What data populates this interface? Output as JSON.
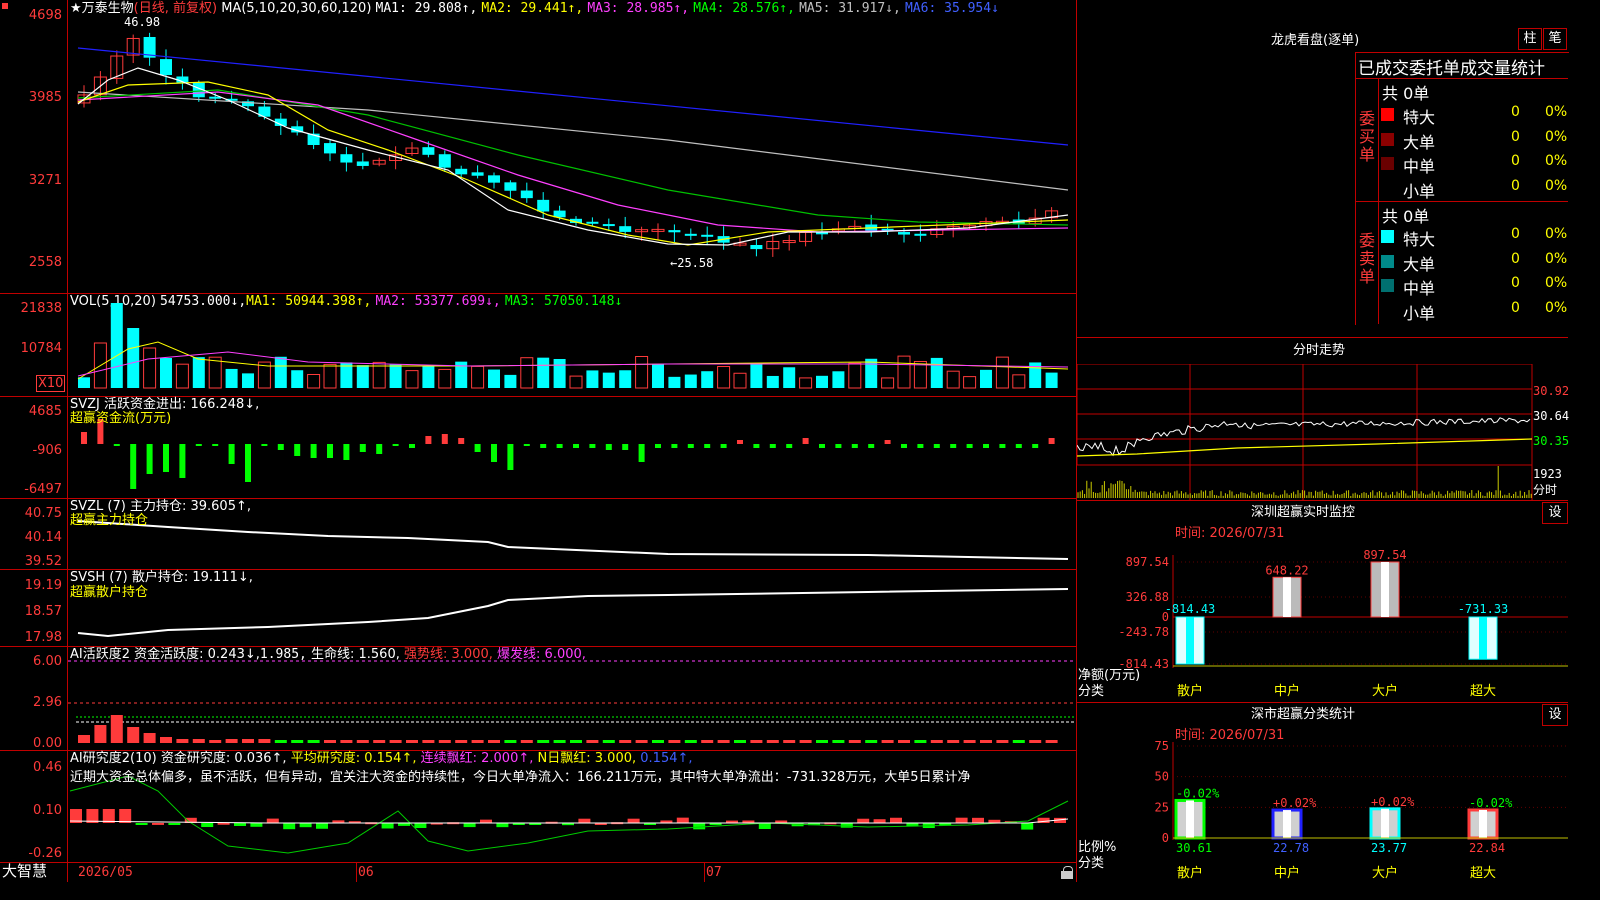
{
  "stock": {
    "name": "★万泰生物",
    "mode": "(日线, 前复权)",
    "ma_label": "MA(5,10,20,30,60,120)",
    "ma": [
      {
        "label": "MA1: 29.808↑,",
        "color": "#ffffff"
      },
      {
        "label": "MA2: 29.441↑,",
        "color": "#ffff00"
      },
      {
        "label": "MA3: 28.985↑,",
        "color": "#ff40ff"
      },
      {
        "label": "MA4: 28.576↑,",
        "color": "#00ff00"
      },
      {
        "label": "MA5: 31.917↓,",
        "color": "#c0c0c0"
      },
      {
        "label": "MA6: 35.954↓",
        "color": "#4060ff"
      }
    ],
    "high_mark": "46.98",
    "low_mark": "←25.58"
  },
  "price_axis": [
    "4698",
    "3985",
    "3271",
    "2558"
  ],
  "vol": {
    "title": "VOL(5,10,20)",
    "value": "54753.000↓,",
    "ma1": "MA1: 50944.398↑,",
    "ma2": "MA2: 53377.699↓,",
    "ma3": "MA3: 57050.148↓",
    "axis": [
      "21838",
      "10784"
    ],
    "unit": "X10"
  },
  "svzj": {
    "title": "SVZJ  活跃资金进出: 166.248↓,",
    "subtitle": "超赢资金流(万元)",
    "axis": [
      "4685",
      "-906",
      "-6497"
    ]
  },
  "svzl": {
    "title": "SVZL (7) 主力持仓: 39.605↑,",
    "subtitle": "超赢主力持仓",
    "axis": [
      "40.75",
      "40.14",
      "39.52"
    ]
  },
  "svsh": {
    "title": "SVSH (7) 散户持仓: 19.111↓,",
    "subtitle": "超赢散户持仓",
    "axis": [
      "19.19",
      "18.57",
      "17.98"
    ]
  },
  "ai1": {
    "t1": "AI活跃度2 资金活跃度: 0.243↓,",
    "t2": "1.985,",
    "t3": "生命线: 1.560,",
    "t4": "强势线: 3.000,",
    "t5": "爆发线: 6.000,",
    "axis": [
      "6.00",
      "2.96",
      "0.00"
    ]
  },
  "ai2": {
    "t1": "AI研究度2(10) 资金研究度: 0.036↑,",
    "t2": "平均研究度: 0.154↑,",
    "t3": "连续飘红: 2.000↑,",
    "t4": "N日飘红: 3.000,",
    "t5": "0.154↑,",
    "comment": "近期大资金总体偏多，虽不活跃，但有异动，宜关注大资金的持续性，今日大单净流入：166.211万元，其中特大单净流出：-731.328万元，大单5日累计净",
    "axis": [
      "0.46",
      "0.10",
      "-0.26"
    ]
  },
  "bottom": {
    "brand": "大智慧",
    "dates": [
      "2026/05",
      "06",
      "07"
    ]
  },
  "lhb": {
    "title": "龙虎看盘(逐单)",
    "btn1": "柱",
    "btn2": "笔",
    "header": "已成交委托单成交量统计",
    "buy_label": "委买单",
    "sell_label": "委卖单",
    "buy_total": "共 0单",
    "sell_total": "共 0单",
    "buy_rows": [
      {
        "name": "特大",
        "val": "0",
        "pct": "0%",
        "color": "#ff0000"
      },
      {
        "name": "大单",
        "val": "0",
        "pct": "0%",
        "color": "#8b0000"
      },
      {
        "name": "中单",
        "val": "0",
        "pct": "0%",
        "color": "#6a0000"
      },
      {
        "name": "小单",
        "val": "0",
        "pct": "0%",
        "color": "#000000"
      }
    ],
    "sell_rows": [
      {
        "name": "特大",
        "val": "0",
        "pct": "0%",
        "color": "#00ffff"
      },
      {
        "name": "大单",
        "val": "0",
        "pct": "0%",
        "color": "#008b8b"
      },
      {
        "name": "中单",
        "val": "0",
        "pct": "0%",
        "color": "#007070"
      },
      {
        "name": "小单",
        "val": "0",
        "pct": "0%",
        "color": "#000000"
      }
    ]
  },
  "fenshi": {
    "title": "分时走势",
    "axis": [
      "30.92",
      "30.64",
      "30.35"
    ],
    "vol": "1923",
    "vol_label": "分时"
  },
  "monitor": {
    "title": "深圳超赢实时监控",
    "btn": "设",
    "time": "时间: 2026/07/31",
    "axis": [
      "897.54",
      "326.88",
      "0",
      "-243.78",
      "-814.43"
    ],
    "side1": "净额(万元)",
    "side2": "分类",
    "bars": [
      {
        "cat": "散户",
        "value": -814.43,
        "label": "-814.43"
      },
      {
        "cat": "中户",
        "value": 648.22,
        "label": "648.22"
      },
      {
        "cat": "大户",
        "value": 897.54,
        "label": "897.54"
      },
      {
        "cat": "超大",
        "value": -731.33,
        "label": "-731.33"
      }
    ]
  },
  "stat": {
    "title": "深市超赢分类统计",
    "btn": "设",
    "time": "时间: 2026/07/31",
    "axis": [
      "75",
      "50",
      "25",
      "0"
    ],
    "side1": "比例%",
    "side2": "分类",
    "bars": [
      {
        "cat": "散户",
        "value": 30.61,
        "label": "30.61",
        "change": "-0.02%"
      },
      {
        "cat": "中户",
        "value": 22.78,
        "label": "22.78",
        "change": "+0.02%"
      },
      {
        "cat": "大户",
        "value": 23.77,
        "label": "23.77",
        "change": "+0.02%"
      },
      {
        "cat": "超大",
        "value": 22.84,
        "label": "22.84",
        "change": "-0.02%"
      }
    ]
  },
  "chart_data": [
    {
      "type": "bar",
      "title": "深圳超赢实时监控",
      "categories": [
        "散户",
        "中户",
        "大户",
        "超大"
      ],
      "values": [
        -814.43,
        648.22,
        897.54,
        -731.33
      ],
      "ylabel": "净额(万元)",
      "ylim": [
        -814.43,
        897.54
      ]
    },
    {
      "type": "bar",
      "title": "深市超赢分类统计",
      "categories": [
        "散户",
        "中户",
        "大户",
        "超大"
      ],
      "values": [
        30.61,
        22.78,
        23.77,
        22.84
      ],
      "ylabel": "比例%",
      "ylim": [
        0,
        75
      ]
    }
  ]
}
